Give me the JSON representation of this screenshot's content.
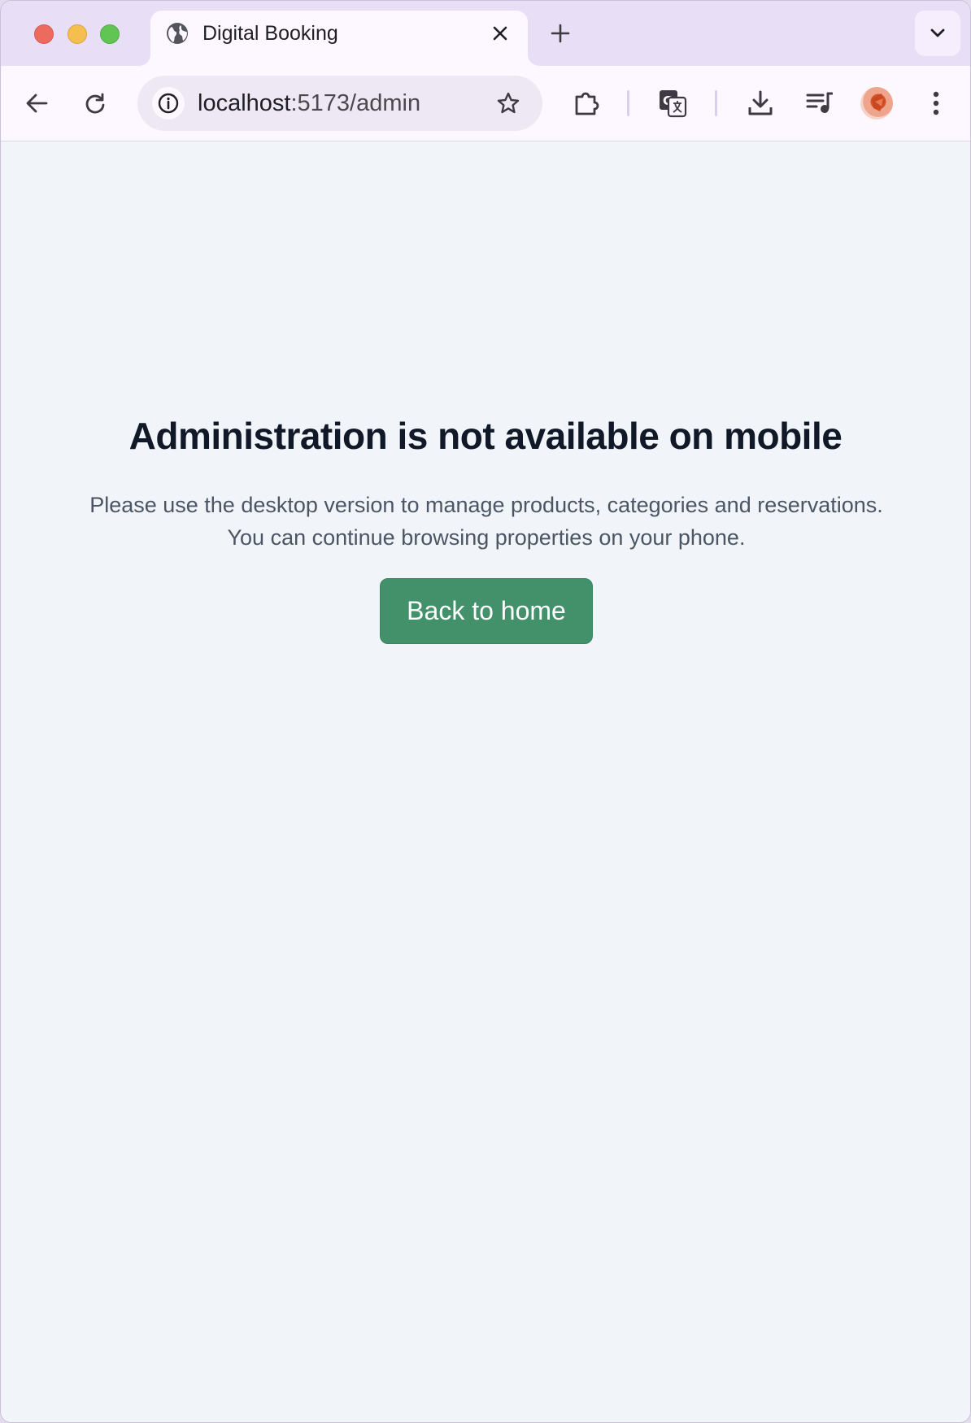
{
  "browser": {
    "tab": {
      "title": "Digital Booking",
      "favicon": "globe-icon"
    },
    "address_bar": {
      "host": "localhost",
      "path": ":5173/admin"
    },
    "colors": {
      "tabstrip": "#e8def5",
      "toolbar": "#fdf7ff"
    }
  },
  "page": {
    "heading": "Administration is not available on mobile",
    "message": "Please use the desktop version to manage products, categories and reservations. You can continue browsing properties on your phone.",
    "back_button_label": "Back to home",
    "colors": {
      "background": "#f1f5fa",
      "button": "#42916b",
      "heading": "#111827",
      "text": "#4b5563"
    }
  }
}
